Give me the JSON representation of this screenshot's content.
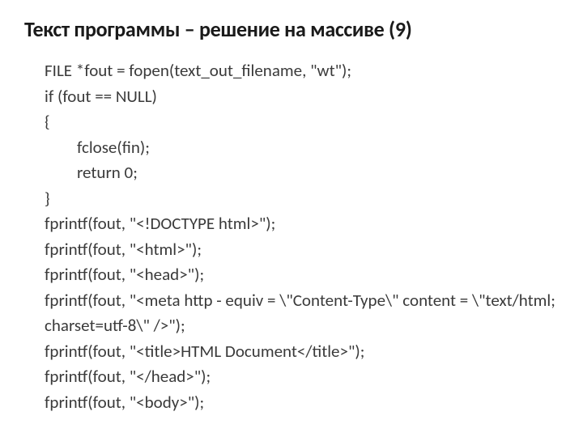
{
  "title": "Текст программы – решение на массиве (9)",
  "code": {
    "line1": "FILE *fout = fopen(text_out_filename, \"wt\");",
    "line2": "if (fout == NULL)",
    "line3": "{",
    "line4": "fclose(fin);",
    "line5": "return 0;",
    "line6": "}",
    "line7": "fprintf(fout, \"<!DOCTYPE html>\");",
    "line8": "fprintf(fout, \"<html>\");",
    "line9": "fprintf(fout, \"<head>\");",
    "line10": "fprintf(fout, \"<meta http - equiv = \\\"Content-Type\\\" content = \\\"text/html; charset=utf-8\\\" />\");",
    "line11": "fprintf(fout, \"<title>HTML Document</title>\");",
    "line12": "fprintf(fout, \"</head>\");",
    "line13": "fprintf(fout, \"<body>\");"
  }
}
